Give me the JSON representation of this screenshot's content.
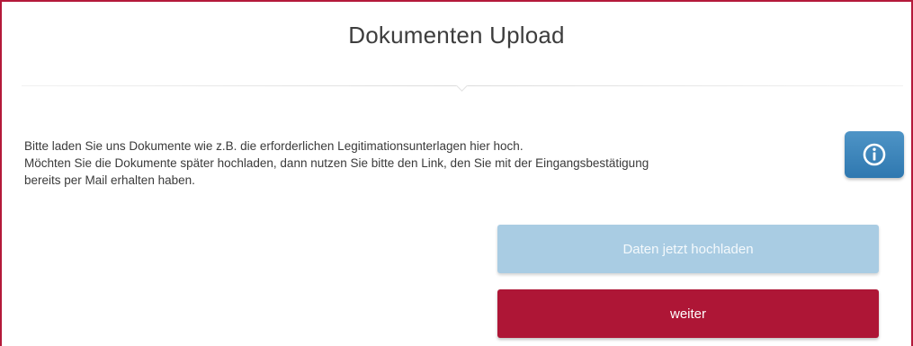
{
  "header": {
    "title": "Dokumenten Upload"
  },
  "description": {
    "lines": [
      "Bitte laden Sie uns Dokumente wie z.B. die erforderlichen Legitimationsunterlagen hier hoch.",
      "Möchten Sie die Dokumente später hochladen, dann nutzen Sie bitte den Link, den Sie mit der Eingangsbestätigung",
      "bereits per Mail erhalten haben."
    ]
  },
  "info": {
    "icon": "info-circle-icon"
  },
  "actions": {
    "upload_label": "Daten jetzt hochladen",
    "next_label": "weiter"
  },
  "colors": {
    "frame_border": "#b4193a",
    "info_button": "#3a82bb",
    "upload_button": "#a9cce3",
    "next_button": "#ae1636"
  }
}
